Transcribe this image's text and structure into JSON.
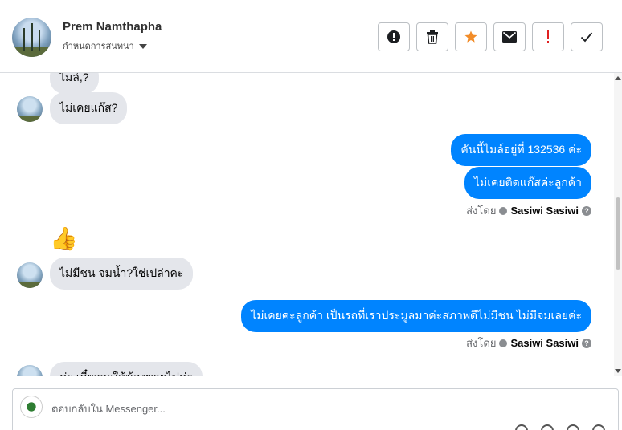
{
  "header": {
    "contact_name": "Prem Namthapha",
    "assign_label": "กำหนดการสนทนา",
    "actions": [
      {
        "name": "spam-button",
        "icon": "alert-circle-icon"
      },
      {
        "name": "delete-button",
        "icon": "trash-icon"
      },
      {
        "name": "star-button",
        "icon": "star-icon",
        "color": "#f28c28"
      },
      {
        "name": "mark-unread-button",
        "icon": "envelope-icon"
      },
      {
        "name": "follow-up-button",
        "icon": "exclamation-icon",
        "color": "#e02020"
      },
      {
        "name": "done-button",
        "icon": "check-icon"
      }
    ]
  },
  "thread": {
    "msg_partial_top": "ไมล์,?",
    "msg_1": "ไม่เคยแก๊ส?",
    "reply_1a": "คันนี้ไมล์อยู่ที่ 132536 ค่ะ",
    "reply_1b": "ไม่เคยติดแก๊สค่ะลูกค้า",
    "sent_by_label": "ส่งโดย",
    "sender_name": "Sasiwi Sasiwi",
    "help_glyph": "?",
    "msg_2_emoji": "👍",
    "msg_3": "ไม่มีชน จมน้ำ?ใช่เปล่าคะ",
    "reply_2": "ไม่เคยค่ะลูกค้า เป็นรถที่เราประมูลมาค่ะสภาพดีไม่มีชน ไม่มีจมเลยค่ะ",
    "msg_partial_bottom": "ค่ะ เดี๋ยวจะให้น้องขายไปค่ะ"
  },
  "composer": {
    "placeholder": "ตอบกลับใน Messenger..."
  },
  "colors": {
    "outgoing_bubble": "#0084ff",
    "incoming_bubble": "#e4e6eb"
  }
}
